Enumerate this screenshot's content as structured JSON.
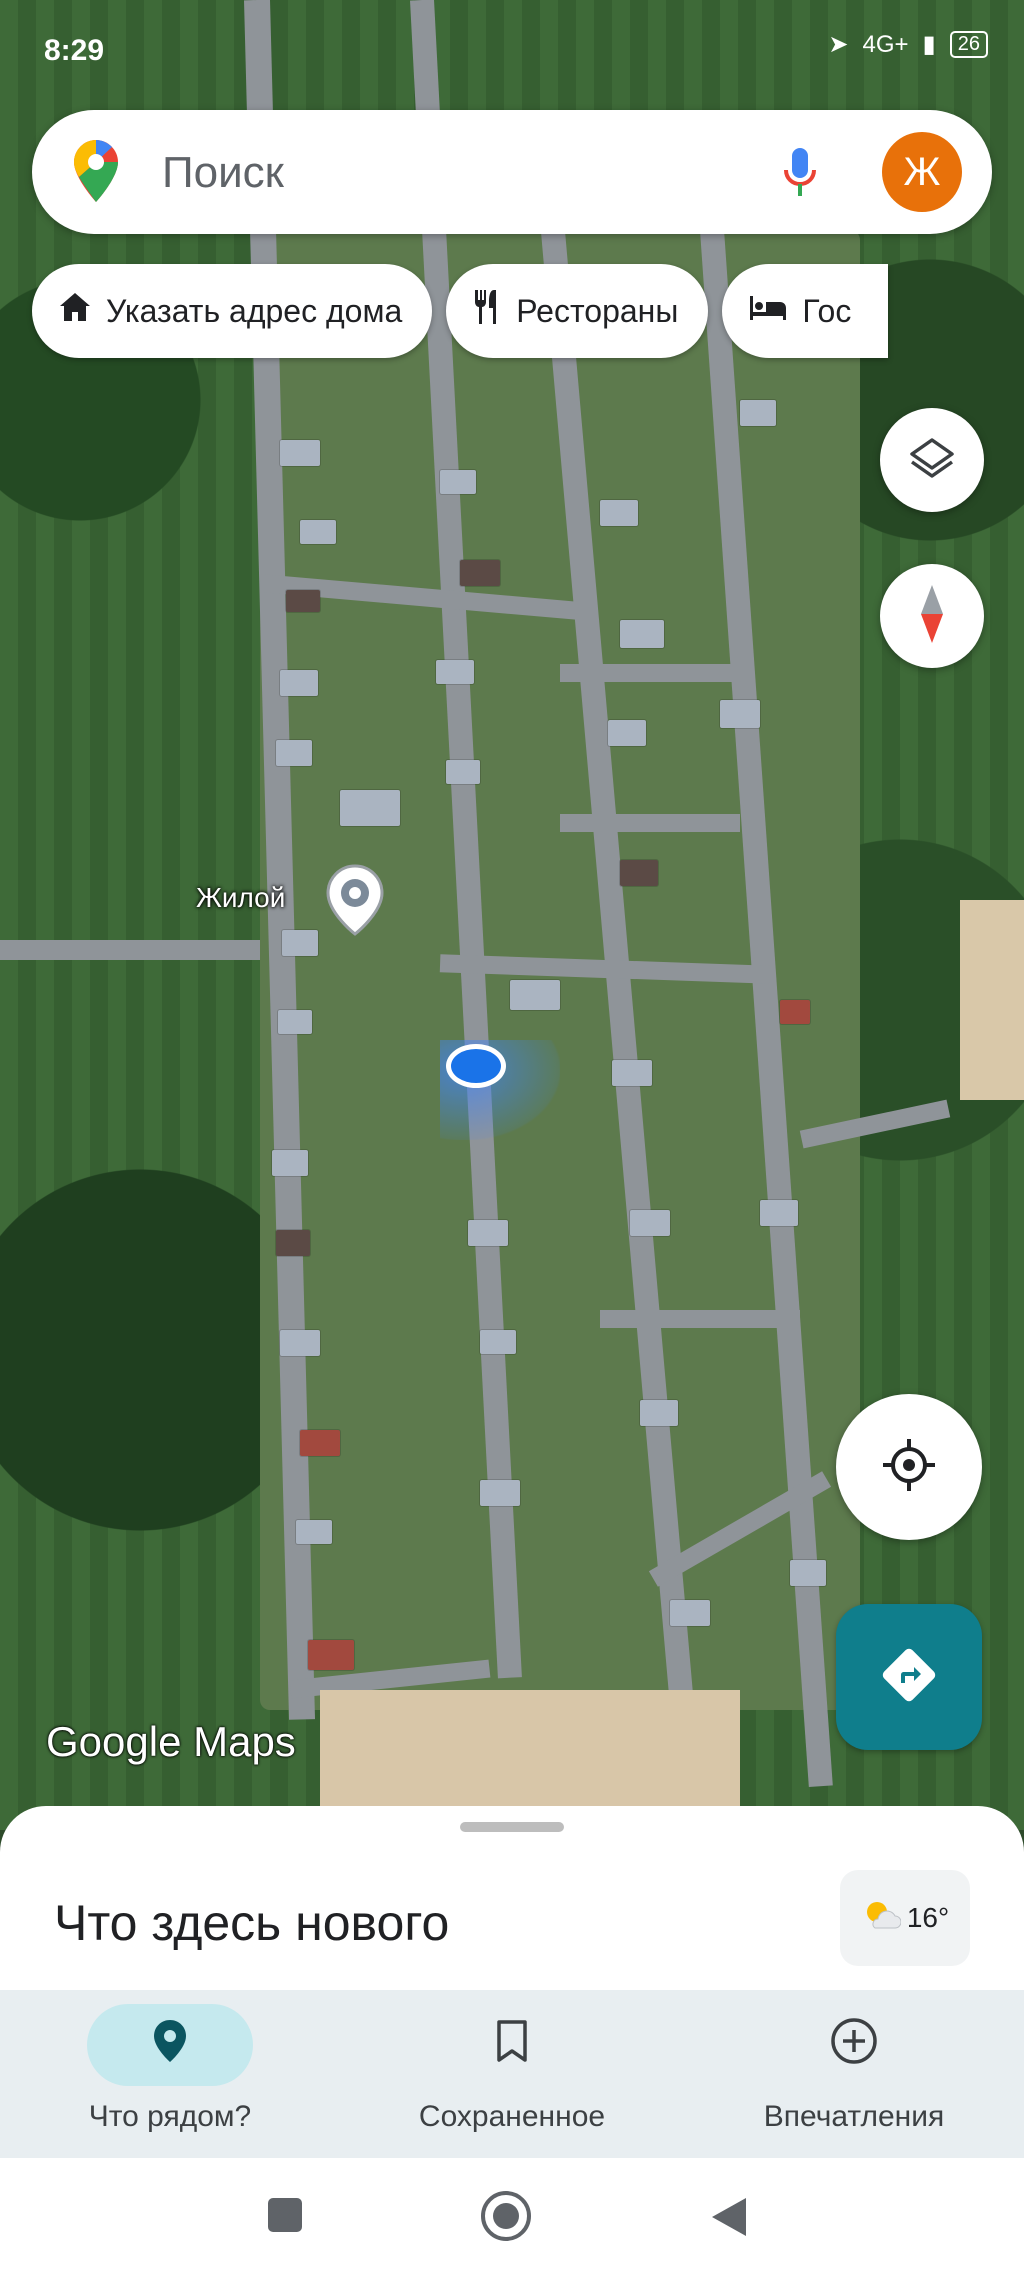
{
  "status_bar": {
    "time": "8:29",
    "network": "4G+",
    "battery": "26"
  },
  "search": {
    "placeholder": "Поиск",
    "avatar_letter": "Ж"
  },
  "chips": [
    {
      "label": "Указать адрес дома",
      "icon": "home-icon"
    },
    {
      "label": "Рестораны",
      "icon": "restaurant-icon"
    },
    {
      "label": "Гос",
      "icon": "hotel-icon"
    }
  ],
  "map": {
    "place_label": "Жилой",
    "watermark": "Google Maps",
    "layers_icon": "layers-icon",
    "compass_icon": "compass-icon",
    "my_location_icon": "my-location-icon",
    "directions_icon": "directions-icon"
  },
  "sheet": {
    "title": "Что здесь нового",
    "weather_temp": "16°"
  },
  "bottom_nav": [
    {
      "label": "Что рядом?",
      "icon": "explore-pin-icon",
      "active": true
    },
    {
      "label": "Сохраненное",
      "icon": "bookmark-icon",
      "active": false
    },
    {
      "label": "Впечатления",
      "icon": "add-circle-icon",
      "active": false
    }
  ],
  "colors": {
    "accent": "#0f7e8c",
    "avatar": "#e8710a",
    "location_dot": "#1a73e8"
  }
}
